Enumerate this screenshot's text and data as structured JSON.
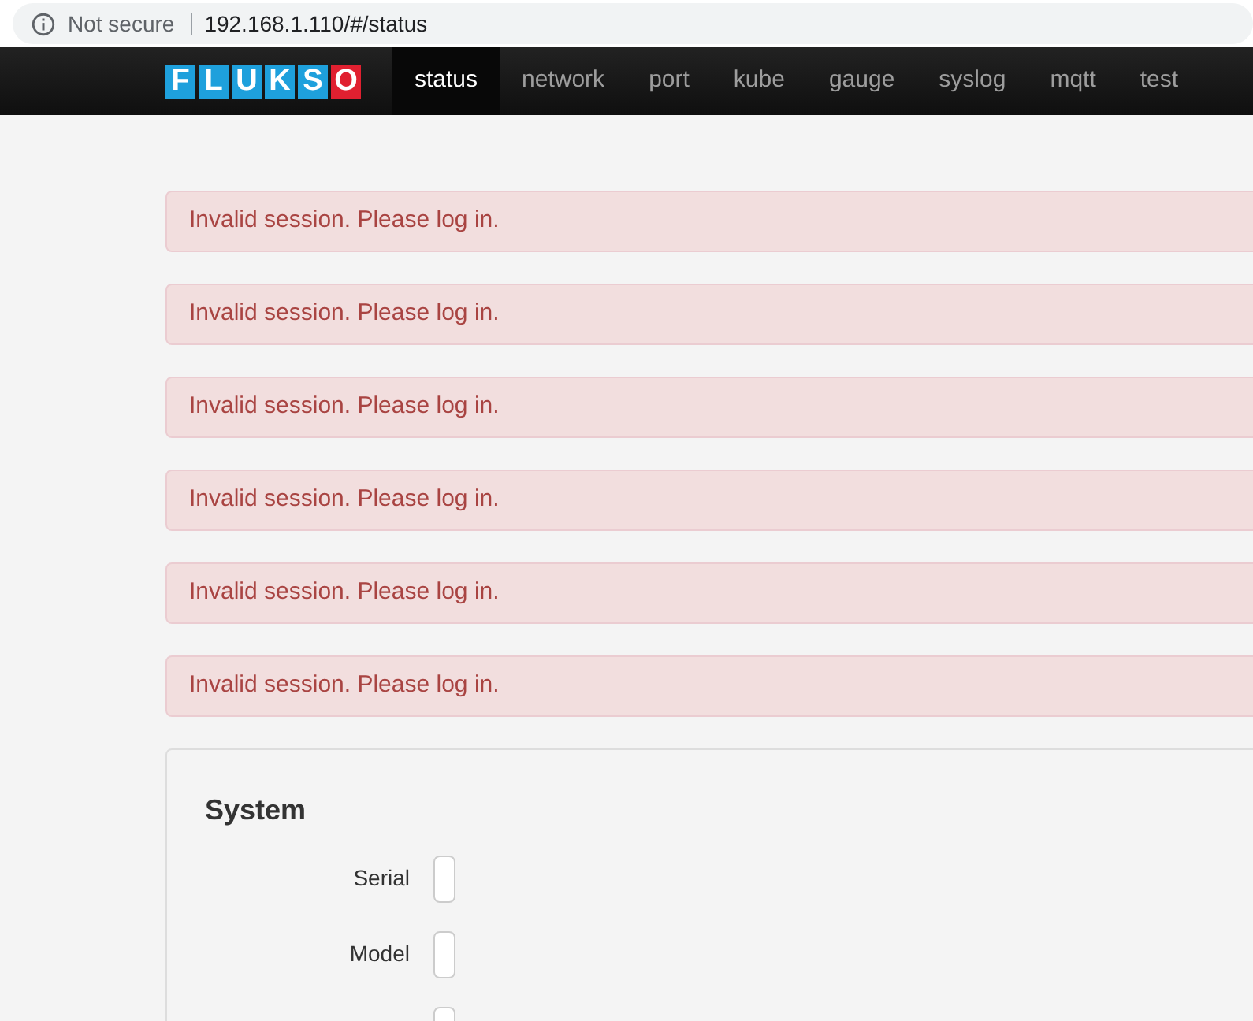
{
  "address_bar": {
    "security": "Not secure",
    "url": "192.168.1.110/#/status"
  },
  "logo": [
    {
      "letter": "F",
      "color": "#1ea0dc"
    },
    {
      "letter": "L",
      "color": "#1ea0dc"
    },
    {
      "letter": "U",
      "color": "#1ea0dc"
    },
    {
      "letter": "K",
      "color": "#1ea0dc"
    },
    {
      "letter": "S",
      "color": "#1ea0dc"
    },
    {
      "letter": "O",
      "color": "#e02030"
    }
  ],
  "nav": [
    {
      "label": "status",
      "selected": true
    },
    {
      "label": "network",
      "selected": false
    },
    {
      "label": "port",
      "selected": false
    },
    {
      "label": "kube",
      "selected": false
    },
    {
      "label": "gauge",
      "selected": false
    },
    {
      "label": "syslog",
      "selected": false
    },
    {
      "label": "mqtt",
      "selected": false
    },
    {
      "label": "test",
      "selected": false
    }
  ],
  "alerts": [
    "Invalid session. Please log in.",
    "Invalid session. Please log in.",
    "Invalid session. Please log in.",
    "Invalid session. Please log in.",
    "Invalid session. Please log in.",
    "Invalid session. Please log in."
  ],
  "panel": {
    "title": "System",
    "fields": [
      {
        "kind": "text",
        "label": "Serial"
      },
      {
        "kind": "text",
        "label": "Model"
      },
      {
        "kind": "text"
      }
    ]
  }
}
